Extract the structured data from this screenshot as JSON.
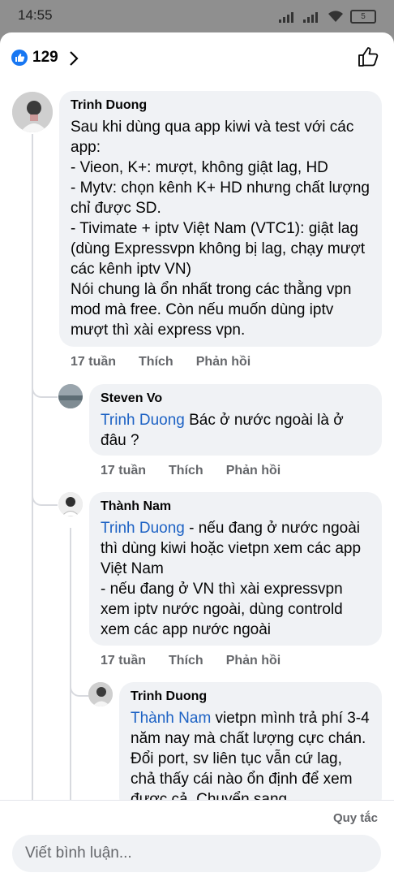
{
  "status_bar": {
    "time": "14:55",
    "battery": "5"
  },
  "header": {
    "reaction_count": "129"
  },
  "comments": [
    {
      "author": "Trinh Duong",
      "mention": "",
      "text": "Sau khi dùng qua app kiwi và test với các app:\n- Vieon, K+: mượt, không giật lag, HD\n- Mytv: chọn kênh K+ HD nhưng chất lượng chỉ được SD.\n- Tivimate + iptv Việt Nam (VTC1): giật lag (dùng Expressvpn không bị lag, chạy mượt các kênh iptv VN)\nNói chung là ổn nhất trong các thằng vpn mod mà free. Còn nếu muốn dùng iptv mượt thì xài express vpn.",
      "time": "17 tuần",
      "like": "Thích",
      "reply": "Phản hồi"
    },
    {
      "author": "Steven Vo",
      "mention": "Trinh Duong",
      "text": " Bác ở nước ngoài là ở đâu ?",
      "time": "17 tuần",
      "like": "Thích",
      "reply": "Phản hồi"
    },
    {
      "author": "Thành Nam",
      "mention": "Trinh Duong",
      "text": " - nếu đang ở nước ngoài thì dùng kiwi hoặc vietpn xem các app Việt Nam\n- nếu đang ở VN thì xài expressvpn xem iptv nước ngoài, dùng controld xem các app nước ngoài",
      "time": "17 tuần",
      "like": "Thích",
      "reply": "Phản hồi"
    },
    {
      "author": "Trinh Duong",
      "mention": "Thành Nam",
      "text": " vietpn mình trả phí 3-4 năm nay mà chất lượng cực chán. Đổi port, sv liên tục vẫn cứ lag, chả thấy cái nào ổn định để xem được cả. Chuyển sang"
    }
  ],
  "footer": {
    "rules": "Quy tắc",
    "composer_placeholder": "Viết bình luận..."
  }
}
